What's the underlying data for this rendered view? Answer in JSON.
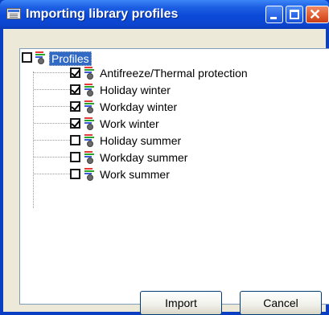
{
  "window": {
    "title": "Importing library profiles",
    "close_glyph": "✕"
  },
  "tree": {
    "root": {
      "label": "Profiles",
      "checked": false
    },
    "items": [
      {
        "label": "Antifreeze/Thermal protection",
        "checked": true
      },
      {
        "label": "Holiday winter",
        "checked": true
      },
      {
        "label": "Workday winter",
        "checked": true
      },
      {
        "label": "Work winter",
        "checked": true
      },
      {
        "label": "Holiday summer",
        "checked": false
      },
      {
        "label": "Workday summer",
        "checked": false
      },
      {
        "label": "Work summer",
        "checked": false
      }
    ]
  },
  "buttons": {
    "import_label": "Import",
    "cancel_label": "Cancel"
  },
  "icons": {
    "window": "window-icon",
    "profile": "profile-icon"
  }
}
